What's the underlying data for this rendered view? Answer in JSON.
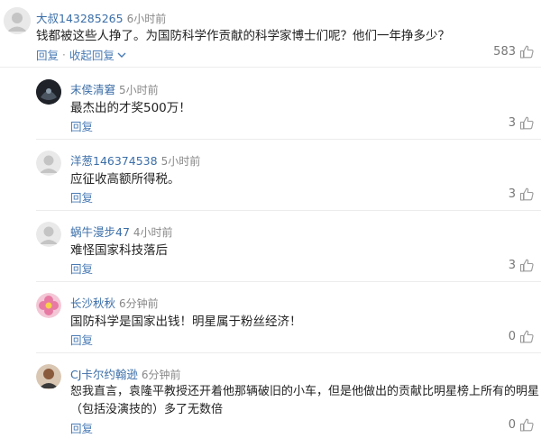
{
  "comment": {
    "user": "大叔143285265",
    "time": "6小时前",
    "text": "钱都被这些人挣了。为国防科学作贡献的科学家博士们呢？他们一年挣多少？",
    "reply_label": "回复",
    "separator": "·",
    "collapse_label": "收起回复",
    "collapse_icon": "chevron-down-icon",
    "likes": "583"
  },
  "replies": [
    {
      "user": "末侯清窘",
      "time": "5小时前",
      "text": "最杰出的才奖500万！",
      "reply_label": "回复",
      "likes": "3"
    },
    {
      "user": "洋葱146374538",
      "time": "5小时前",
      "text": "应征收高额所得税。",
      "reply_label": "回复",
      "likes": "3"
    },
    {
      "user": "蜗牛漫步47",
      "time": "4小时前",
      "text": "难怪国家科技落后",
      "reply_label": "回复",
      "likes": "3"
    },
    {
      "user": "长沙秋秋",
      "time": "6分钟前",
      "text": "国防科学是国家出钱！明星属于粉丝经济！",
      "reply_label": "回复",
      "likes": "0"
    },
    {
      "user": "CJ卡尔约翰逊",
      "time": "6分钟前",
      "text_line1": "恕我直言，袁隆平教授还开着他那辆破旧的小车，但是他做出的贡献比明星榜上所有的明星",
      "text_line2": "（包括没演技的）多了无数倍",
      "reply_label": "回复",
      "likes": "0"
    }
  ],
  "colors": {
    "link": "#4a7bb5",
    "username": "#3b6ea8",
    "muted": "#888888"
  }
}
